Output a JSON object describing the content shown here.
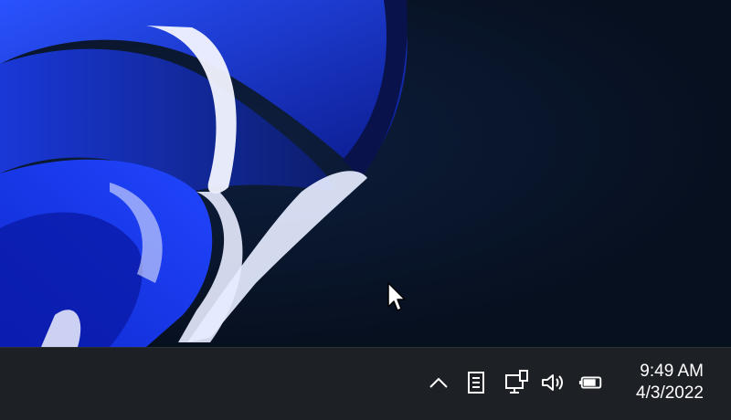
{
  "desktop": {
    "wallpaper": "windows-bloom-wallpaper"
  },
  "taskbar": {
    "tray_icons": [
      {
        "name": "chevron-up-icon",
        "label": "Show hidden icons"
      },
      {
        "name": "notepad-icon",
        "label": "Notes"
      },
      {
        "name": "network-icon",
        "label": "Network"
      },
      {
        "name": "volume-icon",
        "label": "Volume"
      },
      {
        "name": "battery-icon",
        "label": "Battery"
      }
    ],
    "clock": {
      "time": "9:49 AM",
      "date": "4/3/2022"
    }
  },
  "colors": {
    "taskbar_bg": "#1d2126",
    "desktop_bg": "#0b1528",
    "bloom_blue": "#1f3fd8"
  }
}
